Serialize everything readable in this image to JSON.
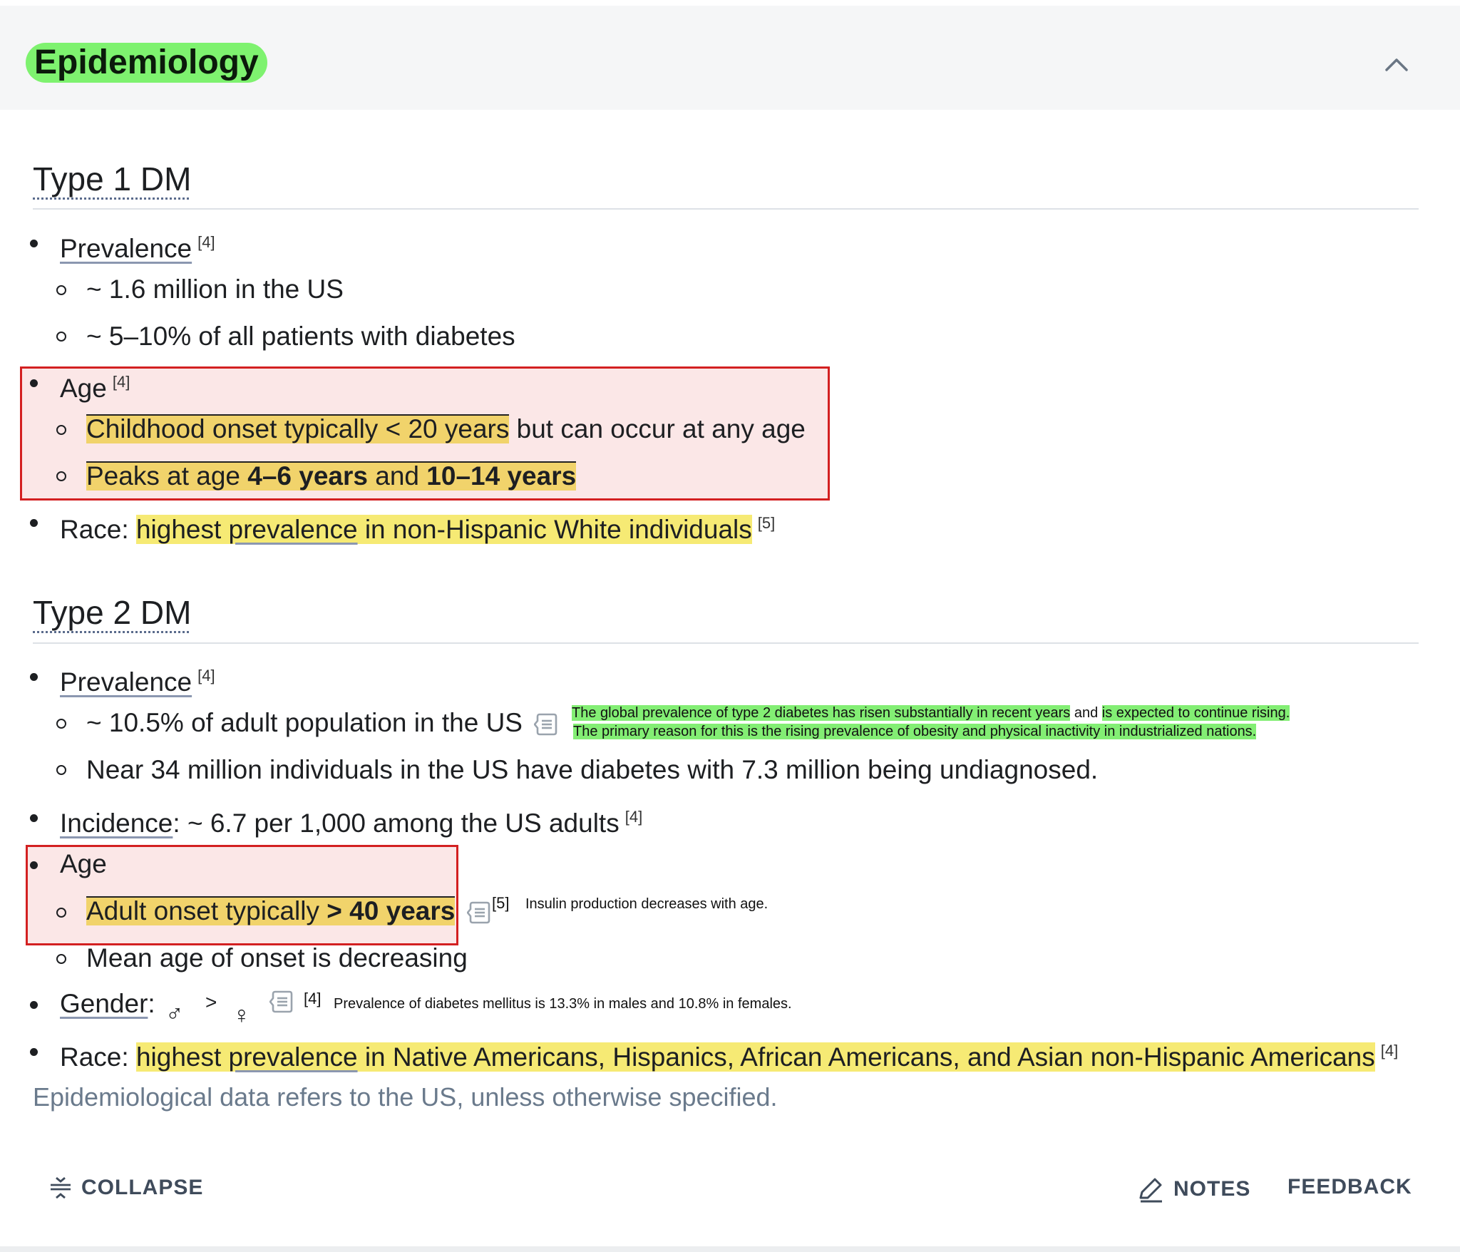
{
  "section_title": "Epidemiology",
  "type1": {
    "heading": "Type 1 DM",
    "prevalence_label": "Prevalence",
    "prevalence_ref": "[4]",
    "prevalence_items": [
      "~ 1.6 million in the US",
      "~ 5–10% of all patients with diabetes"
    ],
    "age_label": "Age",
    "age_ref": "[4]",
    "age_item1_highlight": "Childhood onset typically < 20 years",
    "age_item1_rest": " but can occur at any age",
    "age_item2_pre": "Peaks at age ",
    "age_item2_b1": "4–6 years",
    "age_item2_mid": " and ",
    "age_item2_b2": "10–14 years",
    "race_label": "Race:",
    "race_hl_a": "highest ",
    "race_hl_link": "prevalence",
    "race_hl_b": " in non-Hispanic White individuals",
    "race_ref": "[5]"
  },
  "type2": {
    "heading": "Type 2 DM",
    "prevalence_label": "Prevalence",
    "prevalence_ref": "[4]",
    "prev_item1": "~ 10.5% of adult population in the US",
    "prev_item1_note_a": "The global prevalence of type 2 diabetes has risen substantially in recent years",
    "prev_item1_note_and": " and ",
    "prev_item1_note_b": "is expected to continue rising.",
    "prev_item1_note_line2": "The primary reason for this is the rising prevalence of obesity and physical inactivity in industrialized nations.",
    "prev_item2": "Near 34 million individuals in the US have diabetes with 7.3 million being undiagnosed.",
    "incidence_label": "Incidence",
    "incidence_text": ": ~ 6.7 per 1,000 among the US adults",
    "incidence_ref": "[4]",
    "age_label": "Age",
    "age_item1_pre": "Adult onset typically ",
    "age_item1_b": "> 40 years",
    "age_item1_ref": "[5]",
    "age_item1_note": "Insulin production decreases with age.",
    "age_item2": "Mean age of onset is decreasing",
    "gender_label": "Gender",
    "gender_colon": ":",
    "gender_male": "♂",
    "gender_gt": ">",
    "gender_female": "♀",
    "gender_ref": "[4]",
    "gender_note": "Prevalence of diabetes mellitus is 13.3% in males and 10.8% in females.",
    "race_label": "Race:",
    "race_hl_a": "highest ",
    "race_hl_link": "prevalence",
    "race_hl_b": " in Native Americans, Hispanics, African Americans, and Asian non-Hispanic Americans",
    "race_ref": "[4]"
  },
  "footnote": "Epidemiological data refers to the US, unless otherwise specified.",
  "footer": {
    "collapse": "COLLAPSE",
    "notes": "NOTES",
    "feedback": "FEEDBACK"
  },
  "colors": {
    "title_highlight": "#7ef26f",
    "yellow_highlight": "#f6ea74",
    "orange_highlight": "#f1d36b",
    "annotation_box": "#d32021"
  }
}
